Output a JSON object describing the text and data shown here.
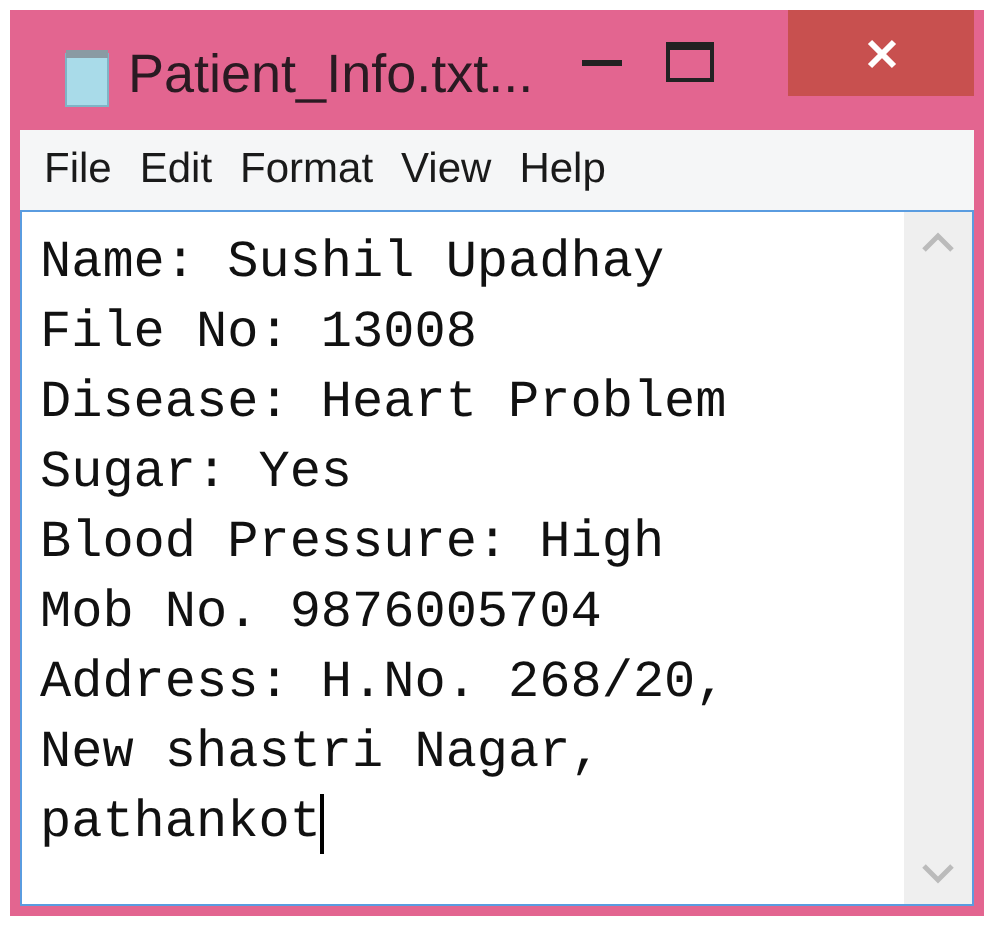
{
  "window": {
    "title": "Patient_Info.txt..."
  },
  "menu": [
    "File",
    "Edit",
    "Format",
    "View",
    "Help"
  ],
  "editor": {
    "lines": [
      "Name: Sushil Upadhay",
      "File No: 13008",
      "Disease: Heart Problem",
      "Sugar: Yes",
      "Blood Pressure: High",
      "Mob No. 9876005704",
      "Address: H.No. 268/20,",
      "New shastri Nagar,",
      "pathankot"
    ]
  }
}
